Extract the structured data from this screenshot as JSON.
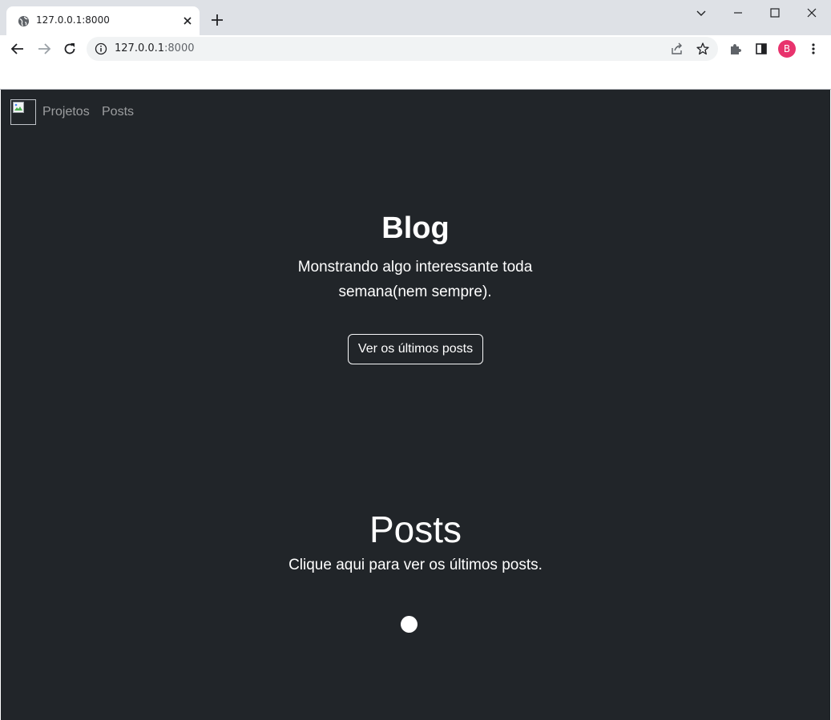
{
  "browser": {
    "tab_title": "127.0.0.1:8000",
    "url_host": "127.0.0.1",
    "url_port": ":8000",
    "profile_initial": "B",
    "profile_color": "#e8336d"
  },
  "navbar": {
    "links": [
      {
        "label": "Projetos"
      },
      {
        "label": "Posts"
      }
    ]
  },
  "hero": {
    "title": "Blog",
    "subtitle": "Monstrando algo interessante toda semana(nem sempre).",
    "button_label": "Ver os últimos posts"
  },
  "posts_section": {
    "title": "Posts",
    "subtitle": "Clique aqui para ver os últimos posts."
  },
  "colors": {
    "page_background": "#212529",
    "text": "#ffffff",
    "nav_link": "rgba(255,255,255,0.55)"
  }
}
